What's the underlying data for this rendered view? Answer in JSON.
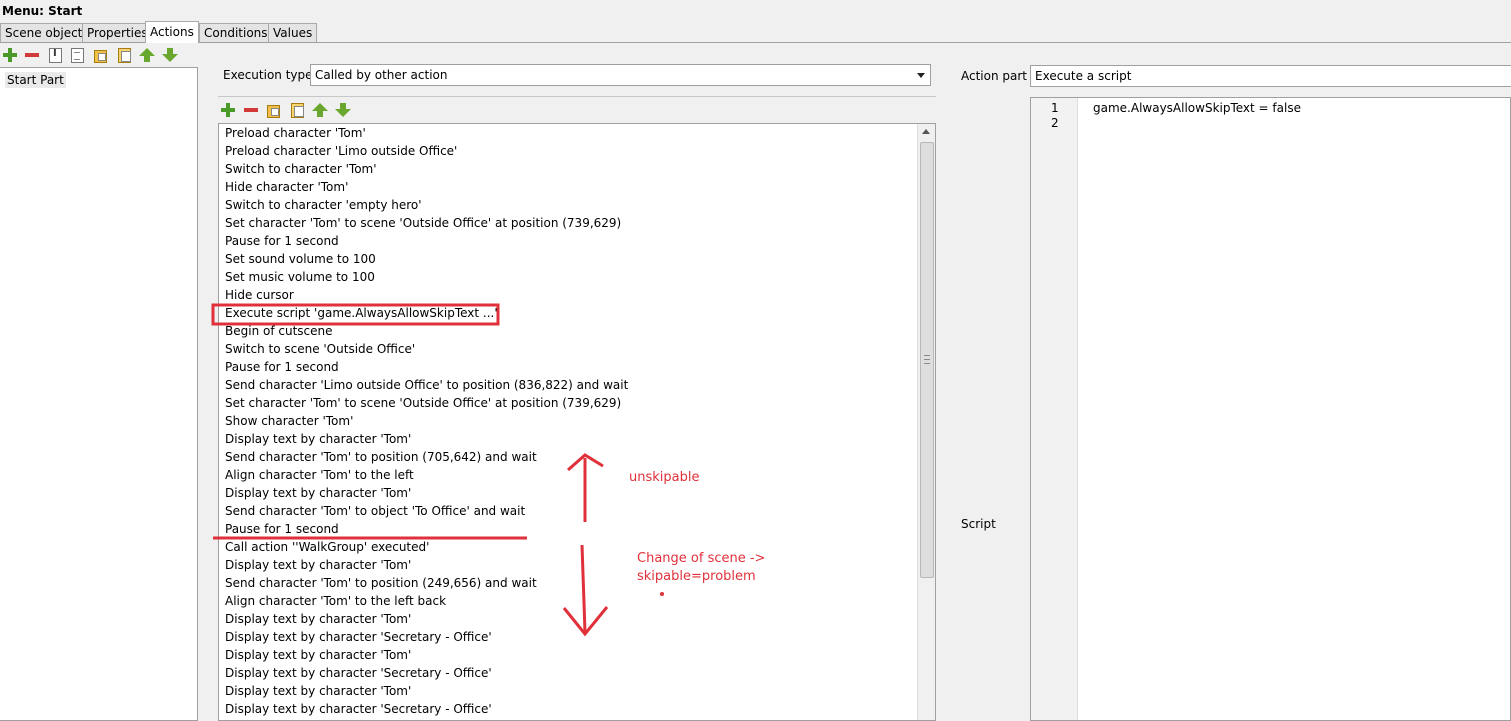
{
  "window": {
    "title": "Menu: Start"
  },
  "tabs": [
    {
      "label": "Scene objects"
    },
    {
      "label": "Properties"
    },
    {
      "label": "Actions",
      "active": true
    },
    {
      "label": "Conditions"
    },
    {
      "label": "Values"
    }
  ],
  "parts": {
    "items": [
      "Start Part"
    ]
  },
  "execution": {
    "label": "Execution type",
    "value": "Called by other action"
  },
  "action_part": {
    "label": "Action part",
    "value": "Execute a script"
  },
  "script": {
    "label": "Script",
    "line_numbers": [
      "1",
      "2"
    ],
    "lines": [
      "game.AlwaysAllowSkipText = false",
      ""
    ]
  },
  "actions": [
    "Preload character 'Tom'",
    "Preload character 'Limo outside Office'",
    "Switch to character 'Tom'",
    "Hide character 'Tom'",
    "Switch to character 'empty hero'",
    "Set character 'Tom' to scene 'Outside Office' at position (739,629)",
    "Pause for 1 second",
    "Set sound volume to 100",
    "Set music volume to 100",
    "Hide cursor",
    "Execute script 'game.AlwaysAllowSkipText ...'",
    "Begin of cutscene",
    "Switch to scene 'Outside Office'",
    "Pause for 1 second",
    "Send character 'Limo outside Office' to position (836,822) and wait",
    "Set character 'Tom' to scene 'Outside Office' at position (739,629)",
    "Show character 'Tom'",
    "Display text by character 'Tom'",
    "Send character 'Tom' to position (705,642) and wait",
    "Align character 'Tom' to the left",
    "Display text by character 'Tom'",
    "Send character 'Tom' to object 'To Office' and wait",
    "Pause for 1 second",
    "Call action ''WalkGroup' executed'",
    "Display text by character 'Tom'",
    "Send character 'Tom' to position (249,656) and wait",
    "Align character 'Tom' to the left back",
    "Display text by character 'Tom'",
    "Display text by character 'Secretary - Office'",
    "Display text by character 'Tom'",
    "Display text by character 'Secretary - Office'",
    "Display text by character 'Tom'",
    "Display text by character 'Secretary - Office'"
  ],
  "annotations": {
    "unskipable": "unskipable",
    "change_line1": "Change of scene ->",
    "change_line2": "skipable=problem",
    "color": "#e0303a"
  },
  "icons": {
    "toolbar": [
      "add-icon",
      "remove-icon",
      "rename-icon",
      "properties-icon",
      "copy-icon",
      "paste-icon",
      "move-up-icon",
      "move-down-icon"
    ]
  }
}
